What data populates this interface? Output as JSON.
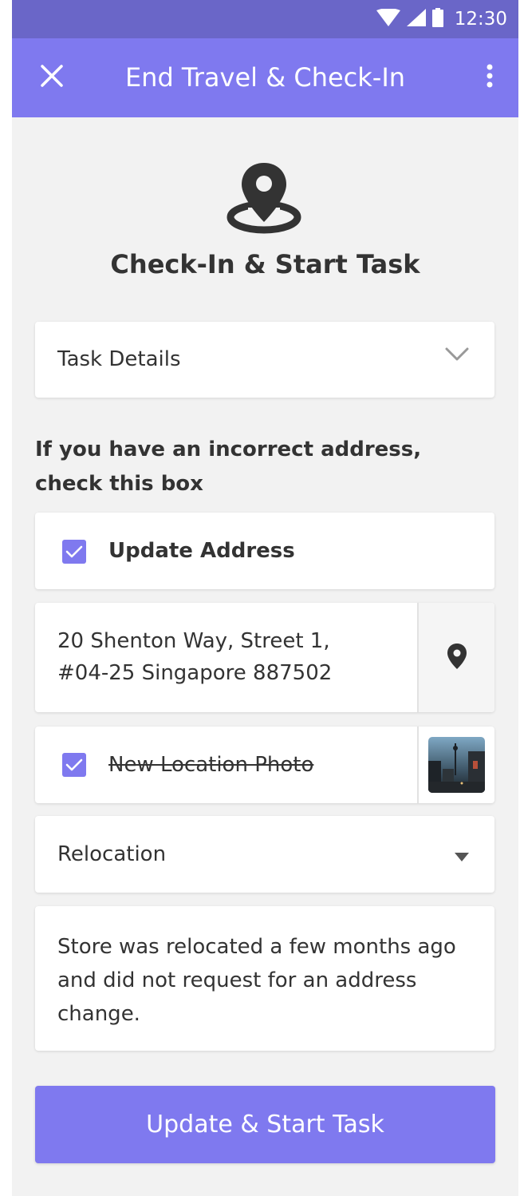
{
  "status_bar": {
    "time": "12:30",
    "icons": [
      "wifi-icon",
      "cell-signal-icon",
      "battery-icon"
    ],
    "background": "#6a66c8"
  },
  "app_bar": {
    "title": "End Travel & Check-In",
    "close_icon": "close-icon",
    "menu_icon": "more-vert-icon",
    "background": "#7f79ef"
  },
  "hero": {
    "icon": "location-pin-icon",
    "title": "Check-In & Start Task"
  },
  "task_details": {
    "label": "Task Details",
    "icon": "chevron-down-icon"
  },
  "instruction": "If you have an incorrect address, check this box",
  "update_address": {
    "label": "Update Address",
    "checked": true
  },
  "address": {
    "line1": "20 Shenton Way, Street 1,",
    "line2": "#04-25 Singapore 887502",
    "icon": "map-pin-icon"
  },
  "photo": {
    "label": "New Location Photo",
    "checked": true,
    "thumbnail": "street-photo-thumbnail"
  },
  "reason": {
    "selected": "Relocation",
    "icon": "dropdown-caret-icon"
  },
  "notes": {
    "text": "Store was relocated a few months ago and did not request for an address change."
  },
  "primary_button": {
    "label": "Update & Start Task"
  },
  "colors": {
    "accent": "#7f79ef",
    "status_bar": "#6a66c8",
    "background": "#f2f2f2",
    "text": "#333333"
  }
}
